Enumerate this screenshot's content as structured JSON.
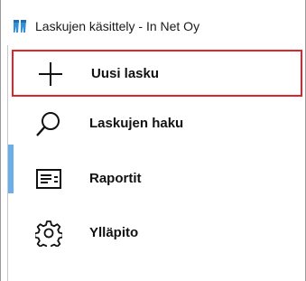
{
  "window": {
    "title": "Laskujen käsittely - In Net Oy",
    "app_icon": "tooth-icon"
  },
  "nav": {
    "items": [
      {
        "label": "Uusi lasku",
        "icon": "plus-icon",
        "state": "focused"
      },
      {
        "label": "Laskujen haku",
        "icon": "search-icon",
        "state": "selected"
      },
      {
        "label": "Raportit",
        "icon": "report-icon",
        "state": "normal"
      },
      {
        "label": "Ylläpito",
        "icon": "gear-icon",
        "state": "normal"
      }
    ]
  },
  "colors": {
    "focus_border": "#e0242b",
    "selection_accent": "#6aaeea",
    "app_icon": "#2f8fd8"
  }
}
